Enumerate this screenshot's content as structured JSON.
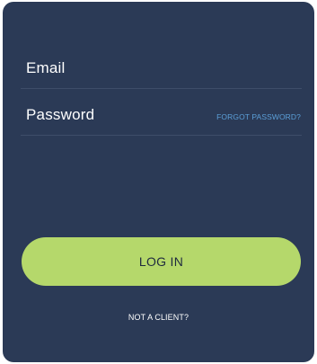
{
  "form": {
    "email": {
      "label": "Email",
      "value": ""
    },
    "password": {
      "label": "Password",
      "value": "",
      "forgot_link": "FORGOT PASSWORD?"
    },
    "login_button": "LOG IN",
    "not_client_link": "NOT A CLIENT?"
  },
  "colors": {
    "card_background": "#2b3a56",
    "accent_button": "#b5d86b",
    "link": "#5b9fd8",
    "text": "#ffffff"
  }
}
